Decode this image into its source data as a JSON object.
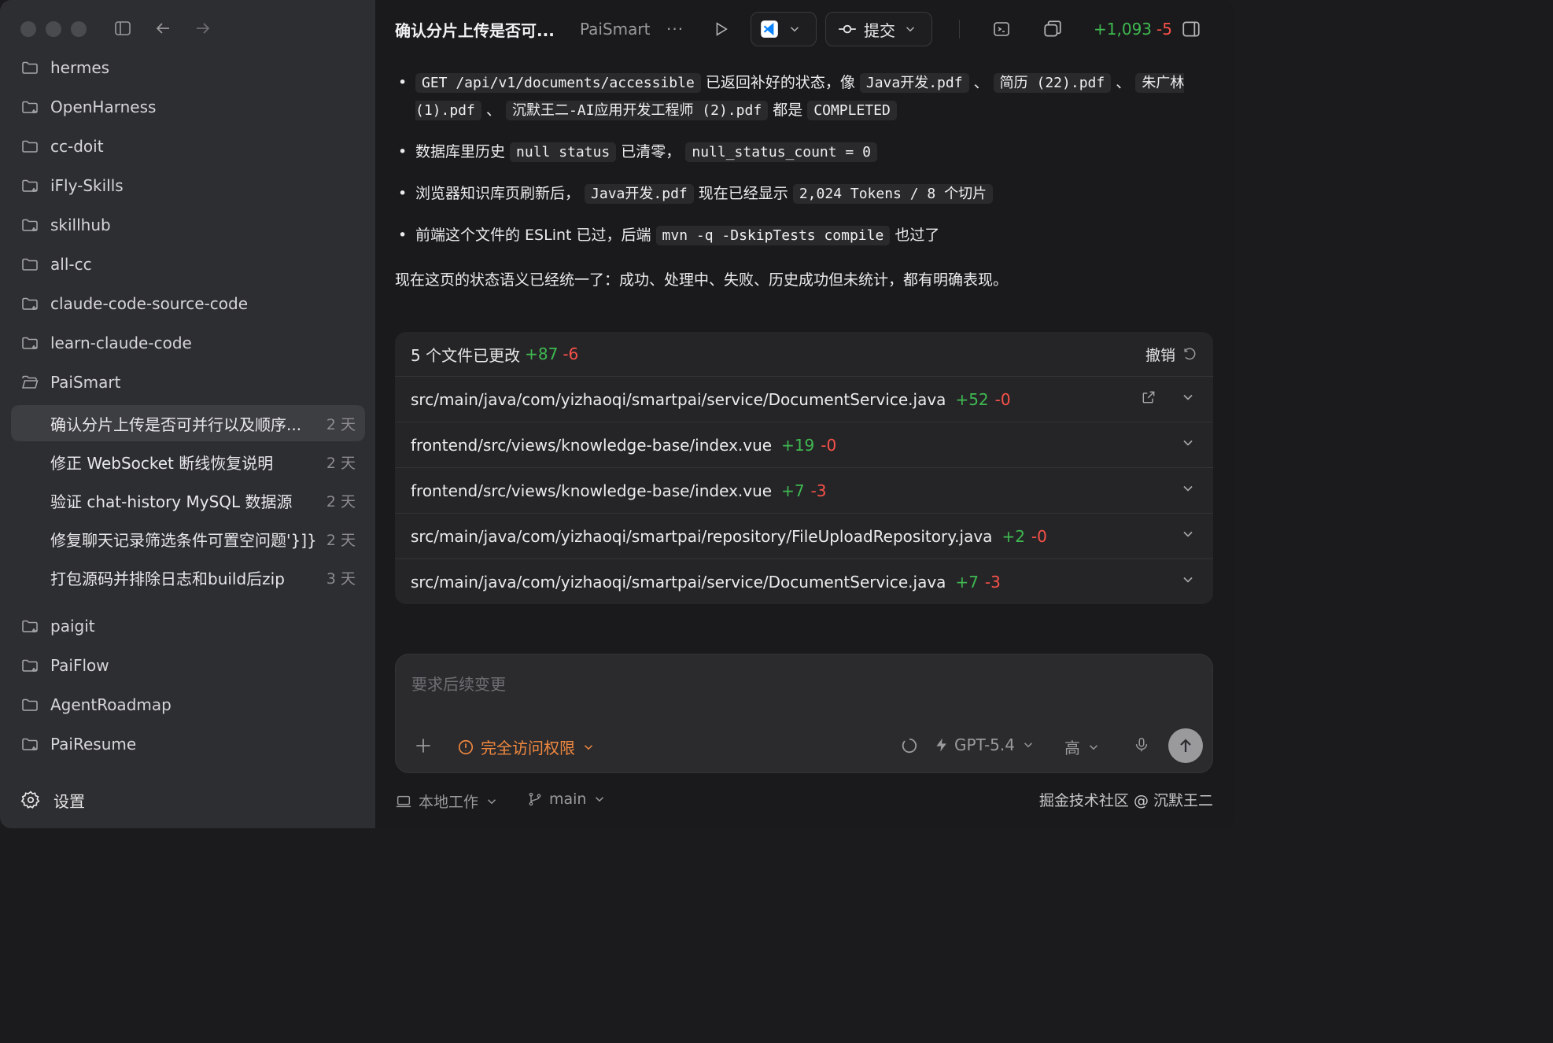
{
  "sidebar": {
    "projects_top": [
      {
        "label": "hermes",
        "icon": "folder-icon"
      },
      {
        "label": "OpenHarness",
        "icon": "folder-git-icon"
      },
      {
        "label": "cc-doit",
        "icon": "folder-icon"
      },
      {
        "label": "iFly-Skills",
        "icon": "folder-git-icon"
      },
      {
        "label": "skillhub",
        "icon": "folder-git-icon"
      },
      {
        "label": "all-cc",
        "icon": "folder-icon"
      },
      {
        "label": "claude-code-source-code",
        "icon": "folder-git-icon"
      },
      {
        "label": "learn-claude-code",
        "icon": "folder-git-icon"
      },
      {
        "label": "PaiSmart",
        "icon": "folder-open-icon"
      }
    ],
    "threads": [
      {
        "title": "确认分片上传是否可并行以及顺序...",
        "age": "2 天",
        "active": true
      },
      {
        "title": "修正 WebSocket 断线恢复说明",
        "age": "2 天",
        "active": false
      },
      {
        "title": "验证 chat-history MySQL 数据源",
        "age": "2 天",
        "active": false
      },
      {
        "title": "修复聊天记录筛选条件可置空问题'}]}",
        "age": "2 天",
        "active": false
      },
      {
        "title": "打包源码并排除日志和build后zip",
        "age": "3 天",
        "active": false
      }
    ],
    "projects_bottom": [
      {
        "label": "paigit",
        "icon": "folder-git-icon"
      },
      {
        "label": "PaiFlow",
        "icon": "folder-git-icon"
      },
      {
        "label": "AgentRoadmap",
        "icon": "folder-icon"
      },
      {
        "label": "PaiResume",
        "icon": "folder-git-icon"
      }
    ],
    "settings_label": "设置"
  },
  "topbar": {
    "title": "确认分片上传是否可...",
    "project": "PaiSmart",
    "more": "···",
    "commit_label": "提交",
    "diff_plus": "+1,093",
    "diff_minus": "-5"
  },
  "message": {
    "bullets": [
      [
        {
          "t": "code",
          "v": "GET /api/v1/documents/accessible"
        },
        {
          "t": "text",
          "v": " 已返回补好的状态，像 "
        },
        {
          "t": "code",
          "v": "Java开发.pdf"
        },
        {
          "t": "text",
          "v": " 、 "
        },
        {
          "t": "code",
          "v": "简历 (22).pdf"
        },
        {
          "t": "text",
          "v": " 、 "
        },
        {
          "t": "code",
          "v": "朱广林 (1).pdf"
        },
        {
          "t": "text",
          "v": " 、 "
        },
        {
          "t": "code",
          "v": "沉默王二-AI应用开发工程师 (2).pdf"
        },
        {
          "t": "text",
          "v": " 都是 "
        },
        {
          "t": "code",
          "v": "COMPLETED"
        }
      ],
      [
        {
          "t": "text",
          "v": "数据库里历史 "
        },
        {
          "t": "code",
          "v": "null status"
        },
        {
          "t": "text",
          "v": " 已清零， "
        },
        {
          "t": "code",
          "v": "null_status_count = 0"
        }
      ],
      [
        {
          "t": "text",
          "v": "浏览器知识库页刷新后， "
        },
        {
          "t": "code",
          "v": "Java开发.pdf"
        },
        {
          "t": "text",
          "v": " 现在已经显示 "
        },
        {
          "t": "code",
          "v": "2,024 Tokens / 8 个切片"
        }
      ],
      [
        {
          "t": "text",
          "v": "前端这个文件的 ESLint 已过，后端 "
        },
        {
          "t": "code",
          "v": "mvn -q -DskipTests compile"
        },
        {
          "t": "text",
          "v": " 也过了"
        }
      ]
    ],
    "summary": "现在这页的状态语义已经统一了：成功、处理中、失败、历史成功但未统计，都有明确表现。"
  },
  "changes": {
    "header_label": "5 个文件已更改",
    "plus": "+87",
    "minus": "-6",
    "undo_label": "撤销",
    "files": [
      {
        "path": "src/main/java/com/yizhaoqi/smartpai/service/DocumentService.java",
        "plus": "+52",
        "minus": "-0"
      },
      {
        "path": "frontend/src/views/knowledge-base/index.vue",
        "plus": "+19",
        "minus": "-0"
      },
      {
        "path": "frontend/src/views/knowledge-base/index.vue",
        "plus": "+7",
        "minus": "-3"
      },
      {
        "path": "src/main/java/com/yizhaoqi/smartpai/repository/FileUploadRepository.java",
        "plus": "+2",
        "minus": "-0"
      },
      {
        "path": "src/main/java/com/yizhaoqi/smartpai/service/DocumentService.java",
        "plus": "+7",
        "minus": "-3"
      }
    ]
  },
  "composer": {
    "placeholder": "要求后续变更",
    "access_label": "完全访问权限",
    "model_label": "GPT-5.4",
    "effort_label": "高"
  },
  "footer": {
    "mode_label": "本地工作",
    "branch_label": "main",
    "watermark": "掘金技术社区 @ 沉默王二"
  },
  "colors": {
    "add": "#3fb950",
    "remove": "#f85149",
    "warning": "#f0883e",
    "vscode_blue": "#0a84ff"
  }
}
